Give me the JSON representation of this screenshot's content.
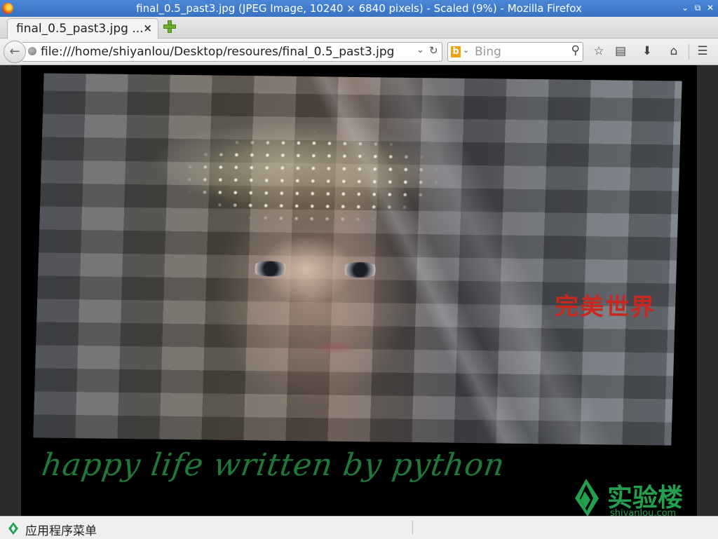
{
  "window": {
    "title": "final_0.5_past3.jpg (JPEG Image, 10240 × 6840 pixels) - Scaled (9%) - Mozilla Firefox",
    "controls": [
      "⌄",
      "⧉",
      "✕"
    ]
  },
  "tabs": [
    {
      "label": "final_0.5_past3.jpg ...",
      "close": "×"
    }
  ],
  "navbar": {
    "url": "file:///home/shiyanlou/Desktop/resoures/final_0.5_past3.jpg",
    "search_engine": "Bing",
    "search_placeholder": "Bing"
  },
  "image": {
    "stamp_text": "完美世界",
    "caption": "happy life written by python",
    "watermark_text": "实验楼",
    "watermark_url": "shiyanlou.com"
  },
  "taskbar": {
    "menu_label": "应用程序菜单"
  },
  "colors": {
    "titlebar": "#3a72c2",
    "caption_green": "#1f7a3a",
    "watermark_green": "#22a050",
    "stamp_red": "#c8281f"
  }
}
